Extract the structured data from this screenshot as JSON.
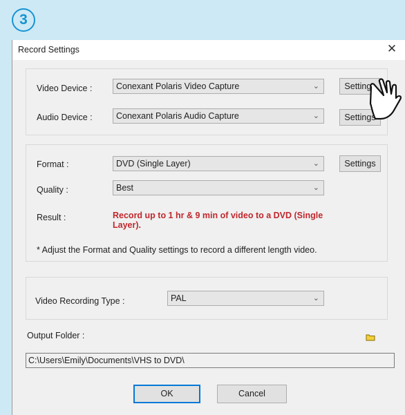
{
  "step": {
    "number": "3"
  },
  "dialog": {
    "title": "Record Settings",
    "close_glyph": "✕"
  },
  "devices": {
    "video_label": "Video Device :",
    "video_value": "Conexant Polaris Video Capture",
    "video_settings": "Settings",
    "audio_label": "Audio Device :",
    "audio_value": "Conexant Polaris Audio Capture",
    "audio_settings": "Settings"
  },
  "format_group": {
    "format_label": "Format :",
    "format_value": "DVD (Single Layer)",
    "format_settings": "Settings",
    "quality_label": "Quality :",
    "quality_value": "Best",
    "result_label": "Result :",
    "result_line1": "Record up to 1 hr & 9 min of  video to a DVD (Single",
    "result_line2": "Layer).",
    "note": "*  Adjust the Format and Quality settings to record a different length video."
  },
  "recording": {
    "type_label": "Video Recording Type :",
    "type_value": "PAL"
  },
  "output": {
    "label": "Output Folder :",
    "path": "C:\\Users\\Emily\\Documents\\VHS to DVD\\"
  },
  "footer": {
    "ok_label": "OK",
    "cancel_label": "Cancel"
  },
  "icons": {
    "dropdown": "chevron-down-icon",
    "folder": "folder-icon",
    "pointer": "hand-pointer-icon"
  },
  "colors": {
    "background": "#cde9f6",
    "accent": "#1793d1",
    "result_text": "#c0272d",
    "dialog": "#f0f0f0"
  }
}
